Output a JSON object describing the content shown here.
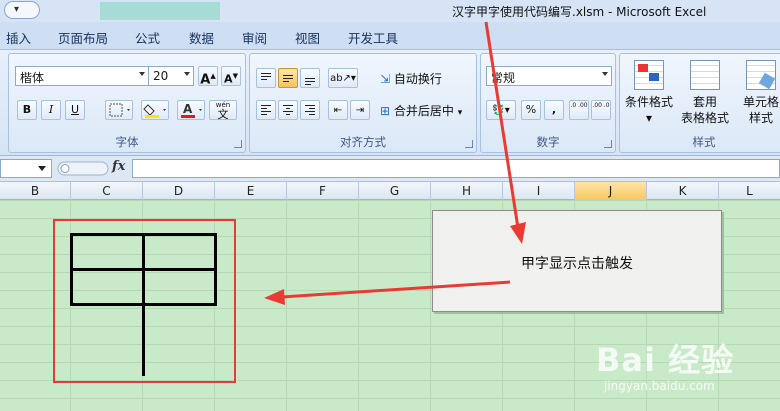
{
  "window": {
    "title": "汉字甲字使用代码编写.xlsm - Microsoft Excel"
  },
  "ribbon_tabs": [
    "插入",
    "页面布局",
    "公式",
    "数据",
    "审阅",
    "视图",
    "开发工具"
  ],
  "ribbon": {
    "font": {
      "font_name": "楷体",
      "font_size": "20",
      "grow_label": "A",
      "shrink_label": "A",
      "bold": "B",
      "italic": "I",
      "underline": "U",
      "wen_label": "wén",
      "wen_char": "文",
      "group_label": "字体"
    },
    "alignment": {
      "wrap_text": "自动换行",
      "merge_center": "合并后居中",
      "group_label": "对齐方式"
    },
    "number": {
      "format": "常规",
      "percent": "%",
      "comma": ",",
      "inc_decimal": ".0 .00",
      "dec_decimal": ".00 .0",
      "group_label": "数字"
    },
    "styles": {
      "conditional_format": [
        "条件格式",
        ""
      ],
      "table_format": [
        "套用",
        "表格格式"
      ],
      "cell_styles": [
        "单元格",
        "样式"
      ],
      "group_label": "样式"
    }
  },
  "formula_bar": {
    "fx_label": "fx",
    "value": ""
  },
  "columns": [
    "B",
    "C",
    "D",
    "E",
    "F",
    "G",
    "H",
    "I",
    "J",
    "K",
    "L"
  ],
  "active_column": "J",
  "sheet_button": {
    "label": "甲字显示点击触发"
  },
  "watermark": {
    "logo": "Bai 经验",
    "url": "jingyan.baidu.com"
  },
  "colors": {
    "sheet_background": "#c9eac8",
    "highlight_frame": "#e93b33",
    "arrow": "#e93b33"
  }
}
